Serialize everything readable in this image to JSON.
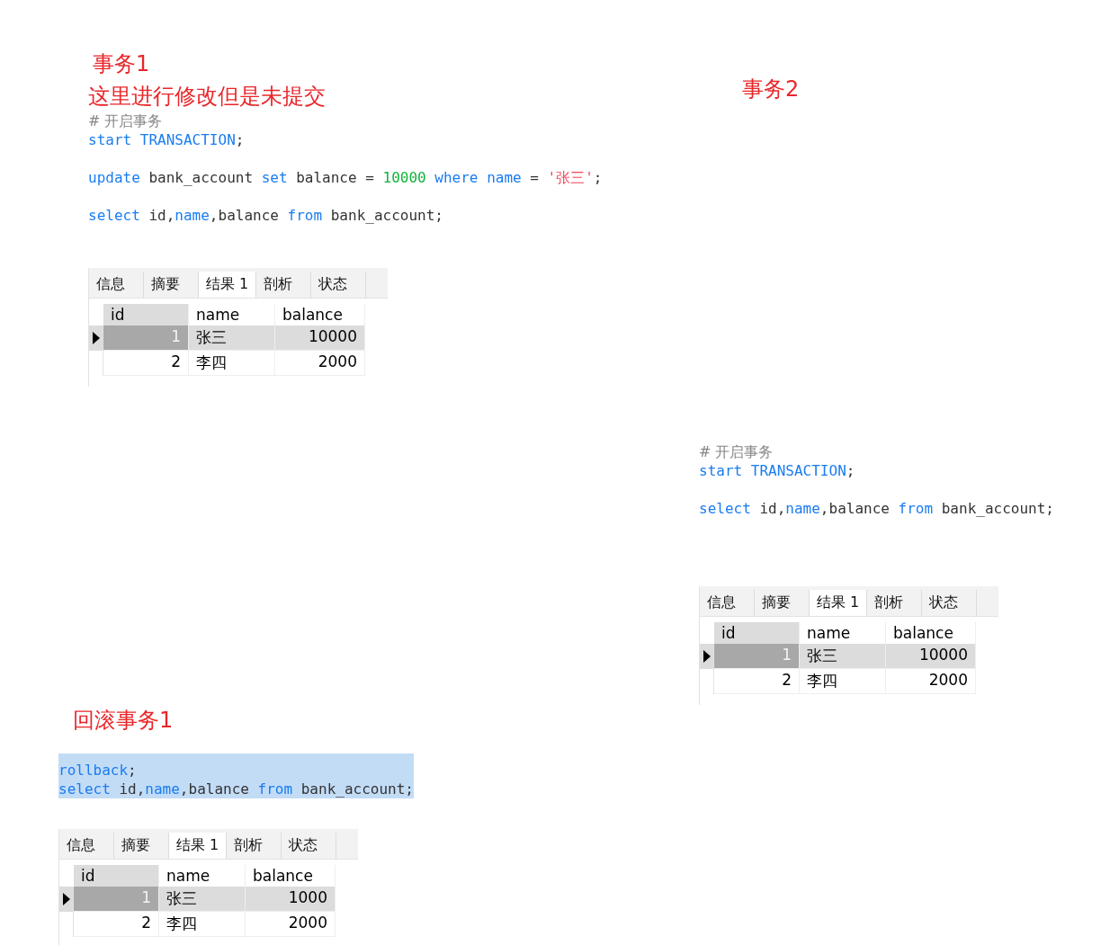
{
  "panels": [
    {
      "heading": "事务1",
      "note": "这里进行修改但是未提交",
      "editor": {
        "selected": false,
        "groups": [
          {
            "lines": [
              {
                "tokens": [
                  {
                    "kind": "comment",
                    "text": "# 开启事务"
                  }
                ]
              },
              {
                "tokens": [
                  {
                    "kind": "keyword",
                    "text": "start TRANSACTION"
                  },
                  {
                    "kind": "plain",
                    "text": ";"
                  }
                ]
              }
            ]
          },
          {
            "lines": [
              {
                "tokens": [
                  {
                    "kind": "keyword",
                    "text": "update"
                  },
                  {
                    "kind": "plain",
                    "text": " bank_account "
                  },
                  {
                    "kind": "keyword",
                    "text": "set"
                  },
                  {
                    "kind": "plain",
                    "text": " balance = "
                  },
                  {
                    "kind": "number",
                    "text": "10000"
                  },
                  {
                    "kind": "keyword",
                    "text": " where name"
                  },
                  {
                    "kind": "plain",
                    "text": " = "
                  },
                  {
                    "kind": "string",
                    "text": "'张三'"
                  },
                  {
                    "kind": "plain",
                    "text": ";"
                  }
                ]
              }
            ]
          },
          {
            "lines": [
              {
                "tokens": [
                  {
                    "kind": "keyword",
                    "text": "select"
                  },
                  {
                    "kind": "plain",
                    "text": " id,"
                  },
                  {
                    "kind": "keyword",
                    "text": "name"
                  },
                  {
                    "kind": "plain",
                    "text": ",balance "
                  },
                  {
                    "kind": "keyword",
                    "text": "from"
                  },
                  {
                    "kind": "plain",
                    "text": " bank_account;"
                  }
                ]
              }
            ]
          }
        ]
      },
      "result": {
        "tabs": [
          {
            "label": "信息",
            "selected": false
          },
          {
            "label": "摘要",
            "selected": false
          },
          {
            "label": "结果 1",
            "selected": true
          },
          {
            "label": "剖析",
            "selected": false
          },
          {
            "label": "状态",
            "selected": false
          }
        ],
        "columns": [
          "id",
          "name",
          "balance"
        ],
        "rows": [
          {
            "selected": true,
            "cells": [
              "1",
              "张三",
              "10000"
            ]
          },
          {
            "selected": false,
            "cells": [
              "2",
              "李四",
              "2000"
            ]
          }
        ]
      }
    },
    {
      "heading": "事务2",
      "editor": {
        "selected": false,
        "groups": [
          {
            "lines": [
              {
                "tokens": [
                  {
                    "kind": "comment",
                    "text": "# 开启事务"
                  }
                ]
              },
              {
                "tokens": [
                  {
                    "kind": "keyword",
                    "text": "start TRANSACTION"
                  },
                  {
                    "kind": "plain",
                    "text": ";"
                  }
                ]
              }
            ]
          },
          {
            "lines": [
              {
                "tokens": [
                  {
                    "kind": "keyword",
                    "text": "select"
                  },
                  {
                    "kind": "plain",
                    "text": " id,"
                  },
                  {
                    "kind": "keyword",
                    "text": "name"
                  },
                  {
                    "kind": "plain",
                    "text": ",balance "
                  },
                  {
                    "kind": "keyword",
                    "text": "from"
                  },
                  {
                    "kind": "plain",
                    "text": " bank_account;"
                  }
                ]
              }
            ]
          }
        ]
      },
      "result": {
        "tabs": [
          {
            "label": "信息",
            "selected": false
          },
          {
            "label": "摘要",
            "selected": false
          },
          {
            "label": "结果 1",
            "selected": true
          },
          {
            "label": "剖析",
            "selected": false
          },
          {
            "label": "状态",
            "selected": false
          }
        ],
        "columns": [
          "id",
          "name",
          "balance"
        ],
        "rows": [
          {
            "selected": true,
            "cells": [
              "1",
              "张三",
              "10000"
            ]
          },
          {
            "selected": false,
            "cells": [
              "2",
              "李四",
              "2000"
            ]
          }
        ]
      }
    },
    {
      "heading": "回滚事务1",
      "editor": {
        "selected": true,
        "groups": [
          {
            "lines": [
              {
                "tokens": [
                  {
                    "kind": "keyword",
                    "text": "rollback"
                  },
                  {
                    "kind": "plain",
                    "text": ";"
                  }
                ]
              },
              {
                "tokens": [
                  {
                    "kind": "keyword",
                    "text": "select"
                  },
                  {
                    "kind": "plain",
                    "text": " id,"
                  },
                  {
                    "kind": "keyword",
                    "text": "name"
                  },
                  {
                    "kind": "plain",
                    "text": ",balance "
                  },
                  {
                    "kind": "keyword",
                    "text": "from"
                  },
                  {
                    "kind": "plain",
                    "text": " bank_account;"
                  }
                ]
              }
            ]
          }
        ]
      },
      "result": {
        "tabs": [
          {
            "label": "信息",
            "selected": false
          },
          {
            "label": "摘要",
            "selected": false
          },
          {
            "label": "结果 1",
            "selected": true
          },
          {
            "label": "剖析",
            "selected": false
          },
          {
            "label": "状态",
            "selected": false
          }
        ],
        "columns": [
          "id",
          "name",
          "balance"
        ],
        "rows": [
          {
            "selected": true,
            "cells": [
              "1",
              "张三",
              "1000"
            ]
          },
          {
            "selected": false,
            "cells": [
              "2",
              "李四",
              "2000"
            ]
          }
        ]
      }
    }
  ]
}
